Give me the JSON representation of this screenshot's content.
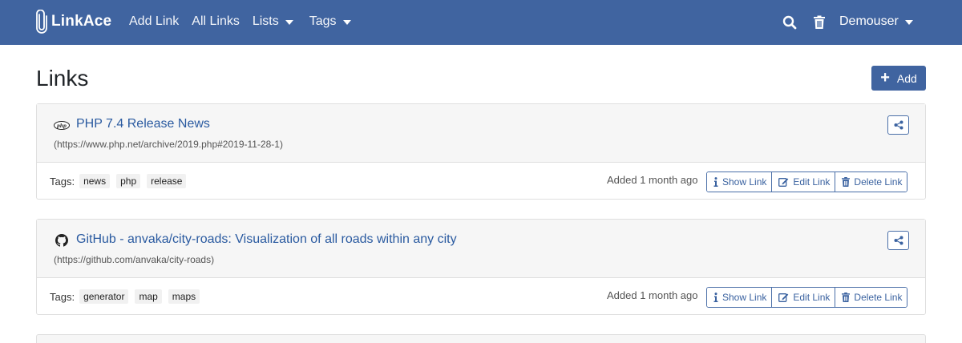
{
  "navbar": {
    "brand": "LinkAce",
    "items": [
      {
        "label": "Add Link"
      },
      {
        "label": "All Links"
      },
      {
        "label": "Lists"
      },
      {
        "label": "Tags"
      }
    ],
    "user": "Demouser",
    "color": "#4064a0"
  },
  "page": {
    "title": "Links",
    "add_label": "Add"
  },
  "links": [
    {
      "title": "PHP 7.4 Release News",
      "url": "(https://www.php.net/archive/2019.php#2019-11-28-1)",
      "icon": "php-icon",
      "tags_label": "Tags:",
      "tags": [
        "news",
        "php",
        "release"
      ],
      "added": "Added 1 month ago",
      "actions": {
        "show": "Show Link",
        "edit": "Edit Link",
        "delete": "Delete Link"
      }
    },
    {
      "title": "GitHub - anvaka/city-roads: Visualization of all roads within any city",
      "url": "(https://github.com/anvaka/city-roads)",
      "icon": "github-icon",
      "tags_label": "Tags:",
      "tags": [
        "generator",
        "map",
        "maps"
      ],
      "added": "Added 1 month ago",
      "actions": {
        "show": "Show Link",
        "edit": "Edit Link",
        "delete": "Delete Link"
      }
    }
  ]
}
